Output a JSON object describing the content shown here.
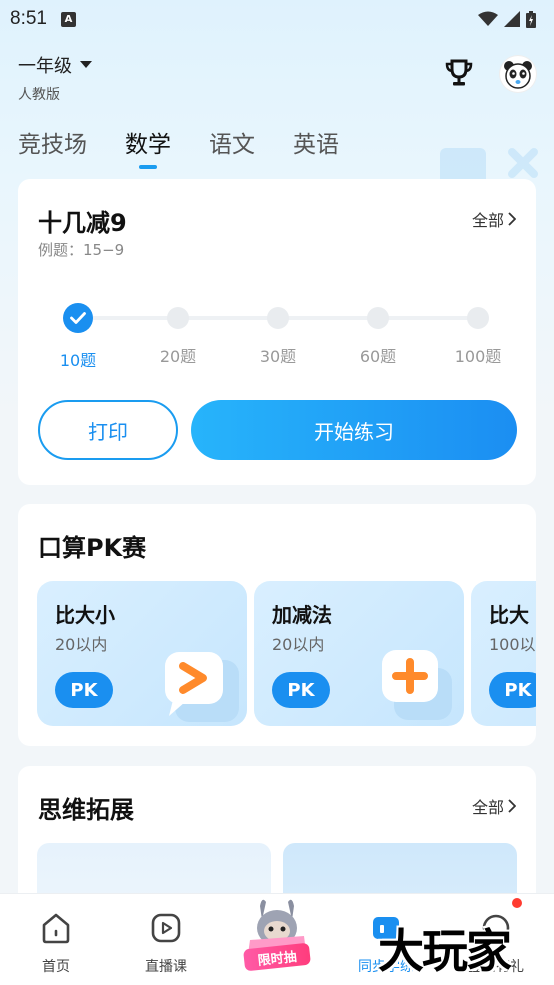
{
  "status": {
    "time": "8:51"
  },
  "header": {
    "grade": "一年级",
    "edition": "人教版"
  },
  "tabs": [
    {
      "label": "竞技场"
    },
    {
      "label": "数学"
    },
    {
      "label": "语文"
    },
    {
      "label": "英语"
    }
  ],
  "practice": {
    "title": "十几减9",
    "example": "例题：15−9",
    "more": "全部",
    "steps": [
      {
        "label": "10题",
        "selected": true
      },
      {
        "label": "20题"
      },
      {
        "label": "30题"
      },
      {
        "label": "60题"
      },
      {
        "label": "100题"
      }
    ],
    "print_label": "打印",
    "start_label": "开始练习"
  },
  "pk": {
    "title": "口算PK赛",
    "cards": [
      {
        "title": "比大小",
        "sub": "20以内",
        "button": "PK"
      },
      {
        "title": "加减法",
        "sub": "20以内",
        "button": "PK"
      },
      {
        "title": "比大",
        "sub": "100以",
        "button": "PK"
      }
    ]
  },
  "thinking": {
    "title": "思维拓展",
    "more": "全部"
  },
  "bottom_nav": [
    {
      "label": "首页"
    },
    {
      "label": "直播课"
    },
    {
      "label": "同步学练",
      "active": true
    },
    {
      "label": "签到有礼"
    }
  ],
  "promo": {
    "label": "限时抽"
  },
  "watermark": "大玩家",
  "colors": {
    "accent": "#1a8ff0"
  }
}
